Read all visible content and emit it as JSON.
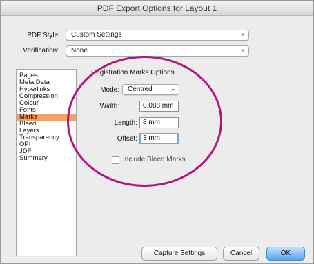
{
  "window": {
    "title": "PDF Export Options for Layout 1"
  },
  "pdf_style": {
    "label": "PDF Style:",
    "value": "Custom Settings",
    "arrows": "÷"
  },
  "verification": {
    "label": "Verification:",
    "value": "None",
    "arrows": "÷"
  },
  "sidebar": {
    "items": [
      {
        "label": "Pages"
      },
      {
        "label": "Meta Data"
      },
      {
        "label": "Hyperlinks"
      },
      {
        "label": "Compression"
      },
      {
        "label": "Colour"
      },
      {
        "label": "Fonts"
      },
      {
        "label": "Marks",
        "selected": true
      },
      {
        "label": "Bleed"
      },
      {
        "label": "Layers"
      },
      {
        "label": "Transparency"
      },
      {
        "label": "OPI"
      },
      {
        "label": "JDF"
      },
      {
        "label": "Summary"
      }
    ]
  },
  "registration": {
    "title": "Registration Marks Options",
    "mode": {
      "label": "Mode:",
      "value": "Centred",
      "arrows": "÷"
    },
    "width": {
      "label": "Width:",
      "value": "0.088 mm"
    },
    "length": {
      "label": "Length:",
      "value": "8 mm"
    },
    "offset": {
      "label": "Offset:",
      "value": "3 mm"
    },
    "include_bleed": {
      "label": "Include Bleed Marks",
      "checked": false
    }
  },
  "buttons": {
    "capture": "Capture Settings",
    "cancel": "Cancel",
    "ok": "OK"
  },
  "colors": {
    "selection": "#f2a266",
    "highlight_ellipse": "#b3157f",
    "default_button": "#5aa6ee"
  }
}
